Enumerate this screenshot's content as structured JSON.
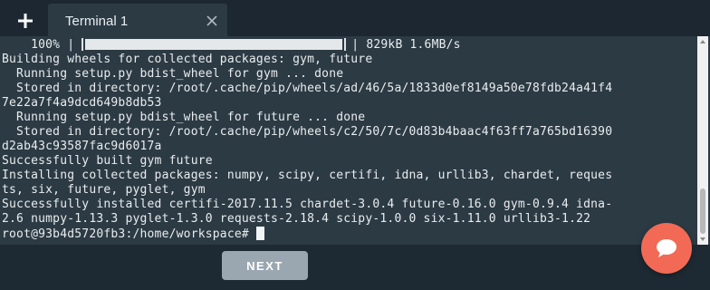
{
  "tab_bar": {
    "add_tab_icon": "plus-icon",
    "tabs": [
      {
        "label": "Terminal 1",
        "close_icon": "close-icon"
      }
    ]
  },
  "terminal": {
    "progress": {
      "percent_label": "    100% |",
      "fraction": 1.0,
      "suffix": "| 829kB 1.6MB/s"
    },
    "lines": [
      "Building wheels for collected packages: gym, future",
      "  Running setup.py bdist_wheel for gym ... done",
      "  Stored in directory: /root/.cache/pip/wheels/ad/46/5a/1833d0ef8149a50e78fdb24a41f4",
      "7e22a7f4a9dcd649b8db53",
      "  Running setup.py bdist_wheel for future ... done",
      "  Stored in directory: /root/.cache/pip/wheels/c2/50/7c/0d83b4baac4f63ff7a765bd16390",
      "d2ab43c93587fac9d6017a",
      "Successfully built gym future",
      "Installing collected packages: numpy, scipy, certifi, idna, urllib3, chardet, reques",
      "ts, six, future, pyglet, gym",
      "Successfully installed certifi-2017.11.5 chardet-3.0.4 future-0.16.0 gym-0.9.4 idna-",
      "2.6 numpy-1.13.3 pyglet-1.3.0 requests-2.18.4 scipy-1.0.0 six-1.11.0 urllib3-1.22"
    ],
    "prompt": "root@93b4d5720fb3:/home/workspace#"
  },
  "footer": {
    "next_label": "NEXT"
  },
  "chat": {
    "icon": "chat-bubble-icon"
  },
  "colors": {
    "background": "#1e2a33",
    "terminal_bg": "#2c3a44",
    "terminal_text": "#e9edef",
    "next_button": "#9aa7b1",
    "chat_fab": "#f26a55"
  }
}
